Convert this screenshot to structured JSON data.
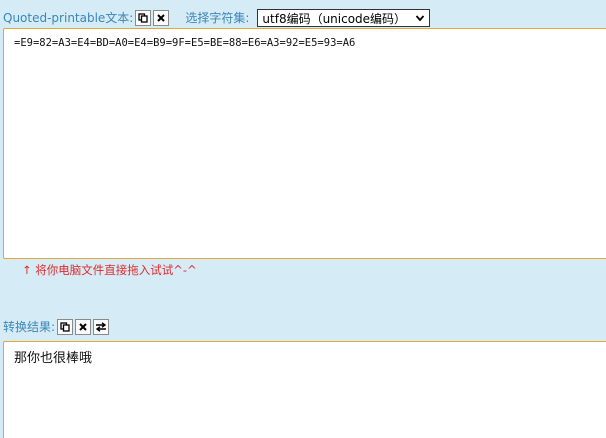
{
  "input_section": {
    "label": "Quoted-printable文本:",
    "copy_icon": "copy-icon",
    "clear_icon": "close-icon",
    "charset_label": "选择字符集:",
    "charset_selected": "utf8编码（unicode编码）",
    "input_value": "=E9=82=A3=E4=BD=A0=E4=B9=9F=E5=BE=88=E6=A3=92=E5=93=A6",
    "drop_hint": "↑ 将你电脑文件直接拖入试试^-^"
  },
  "result_section": {
    "label": "转换结果:",
    "copy_icon": "copy-icon",
    "clear_icon": "close-icon",
    "swap_icon": "swap-icon",
    "output_value": "那你也很棒哦"
  },
  "colors": {
    "background": "#d5ebf6",
    "label_blue": "#3a86b8",
    "textarea_border": "#e5a63a",
    "hint_red": "#e12a2a"
  }
}
